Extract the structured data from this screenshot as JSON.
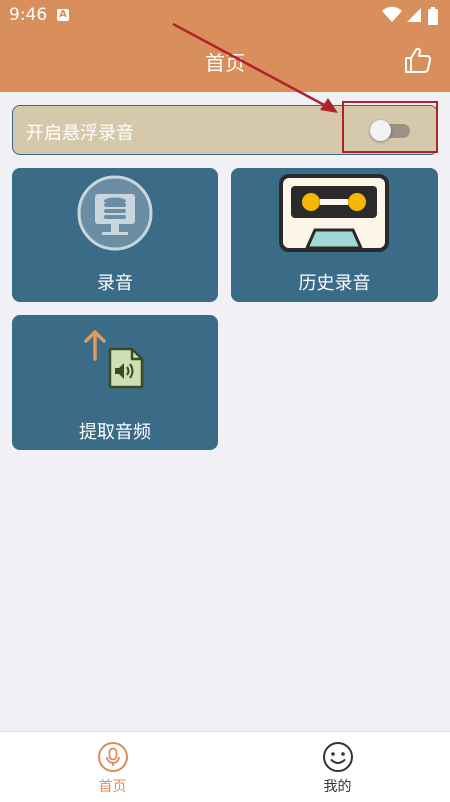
{
  "status_bar": {
    "time": "9:46",
    "a_icon": "A",
    "icons": [
      "wifi-icon",
      "signal-icon",
      "battery-icon"
    ]
  },
  "header": {
    "title": "首页",
    "like_icon": "thumbs-up-icon"
  },
  "float_record": {
    "label": "开启悬浮录音",
    "enabled": false
  },
  "tiles": [
    {
      "label": "录音",
      "icon": "record-database-icon"
    },
    {
      "label": "历史录音",
      "icon": "cassette-tape-icon"
    },
    {
      "label": "提取音频",
      "icon": "extract-audio-icon"
    }
  ],
  "bottom_nav": [
    {
      "label": "首页",
      "icon": "microphone-icon",
      "active": true
    },
    {
      "label": "我的",
      "icon": "smiley-face-icon",
      "active": false
    }
  ],
  "colors": {
    "header": "#d88f5c",
    "tile": "#3a6b87",
    "toggle_row": "#d6c9ab",
    "accent": "#d88f5c",
    "annotation": "#b0222b"
  }
}
